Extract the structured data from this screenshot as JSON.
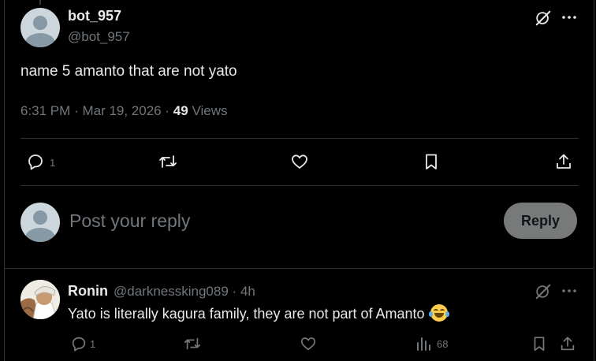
{
  "post": {
    "display_name": "bot_957",
    "handle": "@bot_957",
    "text": "name 5 amanto that are not yato",
    "time": "6:31 PM",
    "separator": "·",
    "date": "Mar 19, 2026",
    "views_count": "49",
    "views_label": "Views",
    "reply_count": "1"
  },
  "composer": {
    "placeholder": "Post your reply",
    "reply_button": "Reply"
  },
  "reply": {
    "display_name": "Ronin",
    "handle": "@darknessking089",
    "separator": "·",
    "age": "4h",
    "text": "Yato is literally kagura family, they are not part of Amanto",
    "reply_count": "1",
    "views_count": "68"
  },
  "icons": {
    "grok": "grok-icon",
    "more": "more-icon",
    "reply": "reply-icon",
    "repost": "repost-icon",
    "like": "like-icon",
    "bookmark": "bookmark-icon",
    "share": "share-icon",
    "views": "views-icon",
    "emoji": "laughing-emoji"
  },
  "colors": {
    "background": "#000000",
    "text": "#e7e9ea",
    "secondary": "#71767b",
    "divider": "#2f3336",
    "reply_button_bg": "#787a7a"
  }
}
